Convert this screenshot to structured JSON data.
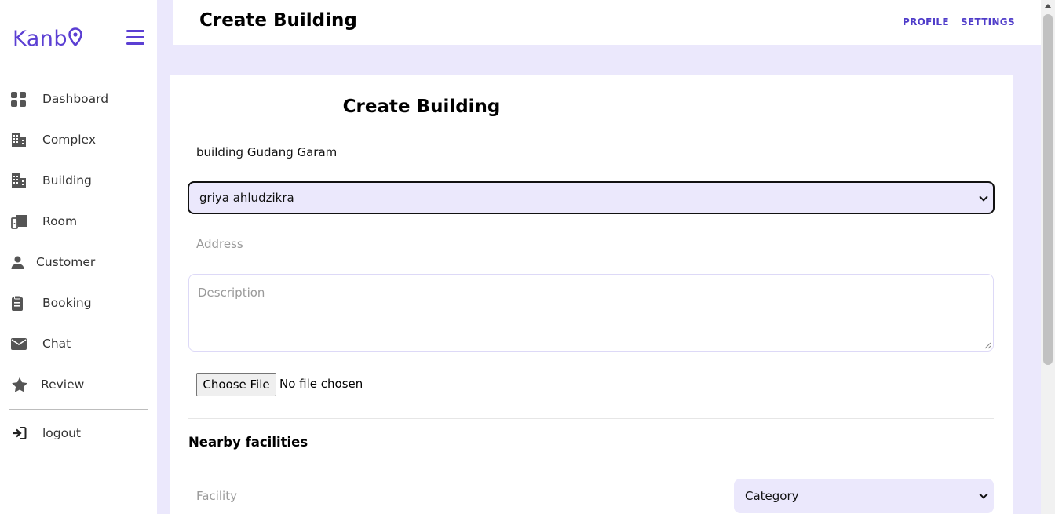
{
  "brand": {
    "name": "Kanb",
    "accent": "#5b3fd3"
  },
  "header": {
    "title": "Create Building",
    "links": [
      "PROFILE",
      "SETTINGS"
    ]
  },
  "sidebar": {
    "items": [
      {
        "label": "Dashboard",
        "icon": "dashboard-icon"
      },
      {
        "label": "Complex",
        "icon": "building-icon"
      },
      {
        "label": "Building",
        "icon": "building-icon"
      },
      {
        "label": "Room",
        "icon": "door-icon"
      },
      {
        "label": "Customer",
        "icon": "user-icon"
      },
      {
        "label": "Booking",
        "icon": "clipboard-icon"
      },
      {
        "label": "Chat",
        "icon": "envelope-icon"
      },
      {
        "label": "Review",
        "icon": "star-icon"
      }
    ],
    "logout": {
      "label": "logout",
      "icon": "logout-icon"
    }
  },
  "form": {
    "title": "Create Building",
    "name_value": "building Gudang Garam",
    "complex_select_value": "griya ahludzikra",
    "address_placeholder": "Address",
    "description_placeholder": "Description",
    "file_button_label": "Choose File",
    "file_status": "No file chosen",
    "nearby_title": "Nearby facilities",
    "facility_placeholder": "Facility",
    "category_select_value": "Category"
  }
}
